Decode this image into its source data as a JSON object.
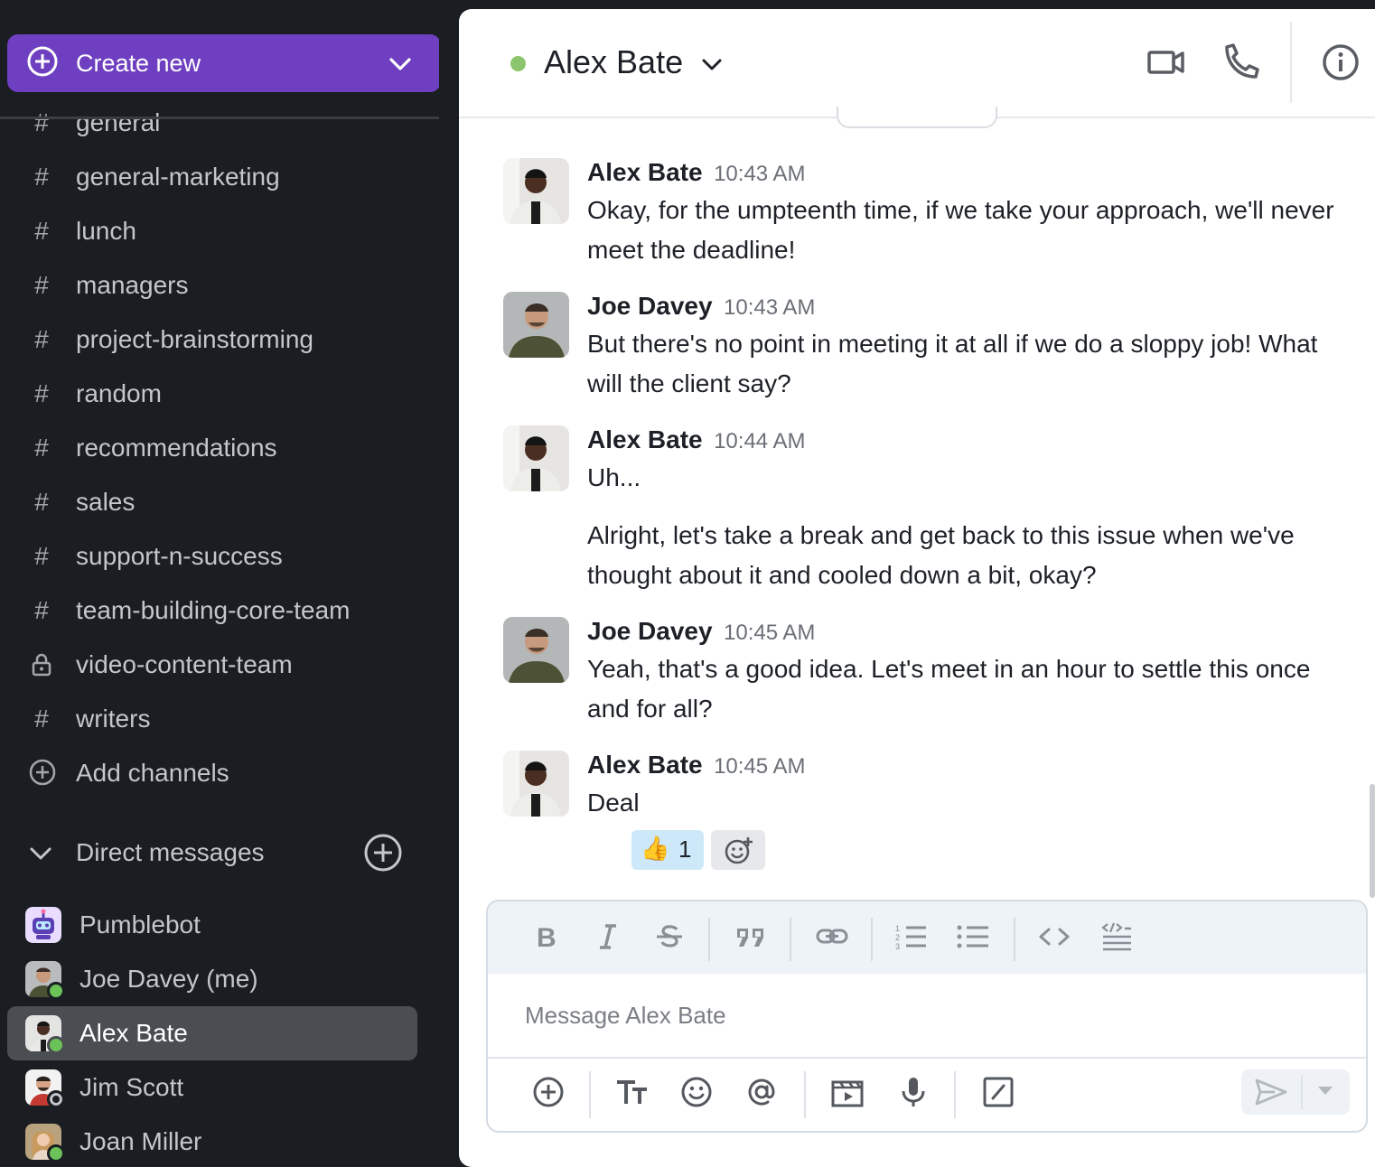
{
  "sidebar": {
    "create_new_label": "Create new",
    "channels": [
      {
        "icon": "hash-icon",
        "label": "general"
      },
      {
        "icon": "hash-icon",
        "label": "general-marketing"
      },
      {
        "icon": "hash-icon",
        "label": "lunch"
      },
      {
        "icon": "hash-icon",
        "label": "managers"
      },
      {
        "icon": "hash-icon",
        "label": "project-brainstorming"
      },
      {
        "icon": "hash-icon",
        "label": "random"
      },
      {
        "icon": "hash-icon",
        "label": "recommendations"
      },
      {
        "icon": "hash-icon",
        "label": "sales"
      },
      {
        "icon": "hash-icon",
        "label": "support-n-success"
      },
      {
        "icon": "hash-icon",
        "label": "team-building-core-team"
      },
      {
        "icon": "lock-icon",
        "label": "video-content-team"
      },
      {
        "icon": "hash-icon",
        "label": "writers"
      }
    ],
    "add_channels_label": "Add channels",
    "dm_section_label": "Direct messages",
    "direct_messages": [
      {
        "label": "Pumblebot",
        "status": "none",
        "active": false
      },
      {
        "label": "Joe Davey (me)",
        "status": "online",
        "active": false
      },
      {
        "label": "Alex Bate",
        "status": "online",
        "active": true
      },
      {
        "label": "Jim Scott",
        "status": "offline",
        "active": false
      },
      {
        "label": "Joan Miller",
        "status": "online",
        "active": false
      }
    ]
  },
  "header": {
    "title": "Alex Bate",
    "presence": "online",
    "icons": [
      "video-camera-icon",
      "phone-icon",
      "info-icon"
    ]
  },
  "messages": [
    {
      "author": "Alex Bate",
      "time": "10:43 AM",
      "lines": [
        "Okay, for the umpteenth time, if we take your approach, we'll never meet the deadline!"
      ]
    },
    {
      "author": "Joe Davey",
      "time": "10:43 AM",
      "lines": [
        "But there's no point in meeting it at all if we do a sloppy job! What will the client say?"
      ]
    },
    {
      "author": "Alex Bate",
      "time": "10:44 AM",
      "lines": [
        "Uh...",
        "Alright, let's take a break and get back to this issue when we've thought about it and cooled down a bit, okay?"
      ]
    },
    {
      "author": "Joe Davey",
      "time": "10:45 AM",
      "lines": [
        "Yeah, that's a good idea. Let's meet in an hour to settle this once and for all?"
      ]
    },
    {
      "author": "Alex Bate",
      "time": "10:45 AM",
      "lines": [
        "Deal"
      ],
      "reactions": [
        {
          "emoji": "👍",
          "count": "1"
        }
      ]
    }
  ],
  "composer": {
    "placeholder": "Message Alex Bate",
    "format_tools": [
      "bold-icon",
      "italic-icon",
      "strikethrough-icon",
      "quote-icon",
      "link-icon",
      "ordered-list-icon",
      "bullet-list-icon",
      "code-icon",
      "code-block-icon"
    ],
    "actions": [
      "attach-icon",
      "text-format-icon",
      "emoji-icon",
      "mention-icon",
      "video-clip-icon",
      "microphone-icon",
      "slash-command-icon"
    ]
  },
  "colors": {
    "sidebar_bg": "#1a1d21",
    "create_new_bg": "#6e3fc0",
    "online": "#6ac259",
    "active_item_bg": "#4a4d52",
    "reaction_bg": "#cde8f8"
  }
}
